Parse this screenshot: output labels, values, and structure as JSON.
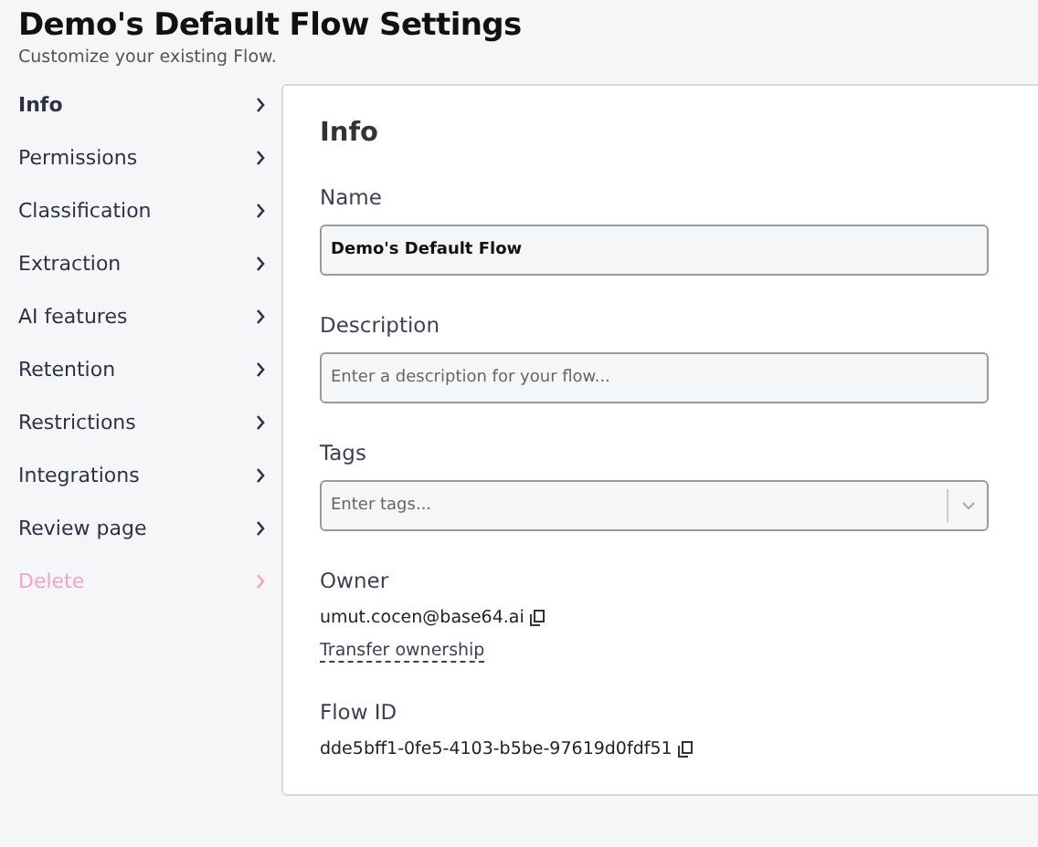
{
  "header": {
    "title": "Demo's Default Flow Settings",
    "subtitle": "Customize your existing Flow."
  },
  "sidebar": {
    "items": [
      {
        "label": "Info",
        "selected": true,
        "kind": "normal"
      },
      {
        "label": "Permissions",
        "selected": false,
        "kind": "normal"
      },
      {
        "label": "Classification",
        "selected": false,
        "kind": "normal"
      },
      {
        "label": "Extraction",
        "selected": false,
        "kind": "normal"
      },
      {
        "label": "AI features",
        "selected": false,
        "kind": "normal"
      },
      {
        "label": "Retention",
        "selected": false,
        "kind": "normal"
      },
      {
        "label": "Restrictions",
        "selected": false,
        "kind": "normal"
      },
      {
        "label": "Integrations",
        "selected": false,
        "kind": "normal"
      },
      {
        "label": "Review page",
        "selected": false,
        "kind": "normal"
      },
      {
        "label": "Delete",
        "selected": false,
        "kind": "danger"
      }
    ]
  },
  "panel": {
    "title": "Info",
    "name": {
      "label": "Name",
      "value": "Demo's Default Flow"
    },
    "description": {
      "label": "Description",
      "placeholder": "Enter a description for your flow..."
    },
    "tags": {
      "label": "Tags",
      "placeholder": "Enter tags..."
    },
    "owner": {
      "label": "Owner",
      "email": "umut.cocen@base64.ai",
      "link": "Transfer ownership"
    },
    "flow_id": {
      "label": "Flow ID",
      "value": "dde5bff1-0fe5-4103-b5be-97619d0fdf51"
    }
  }
}
